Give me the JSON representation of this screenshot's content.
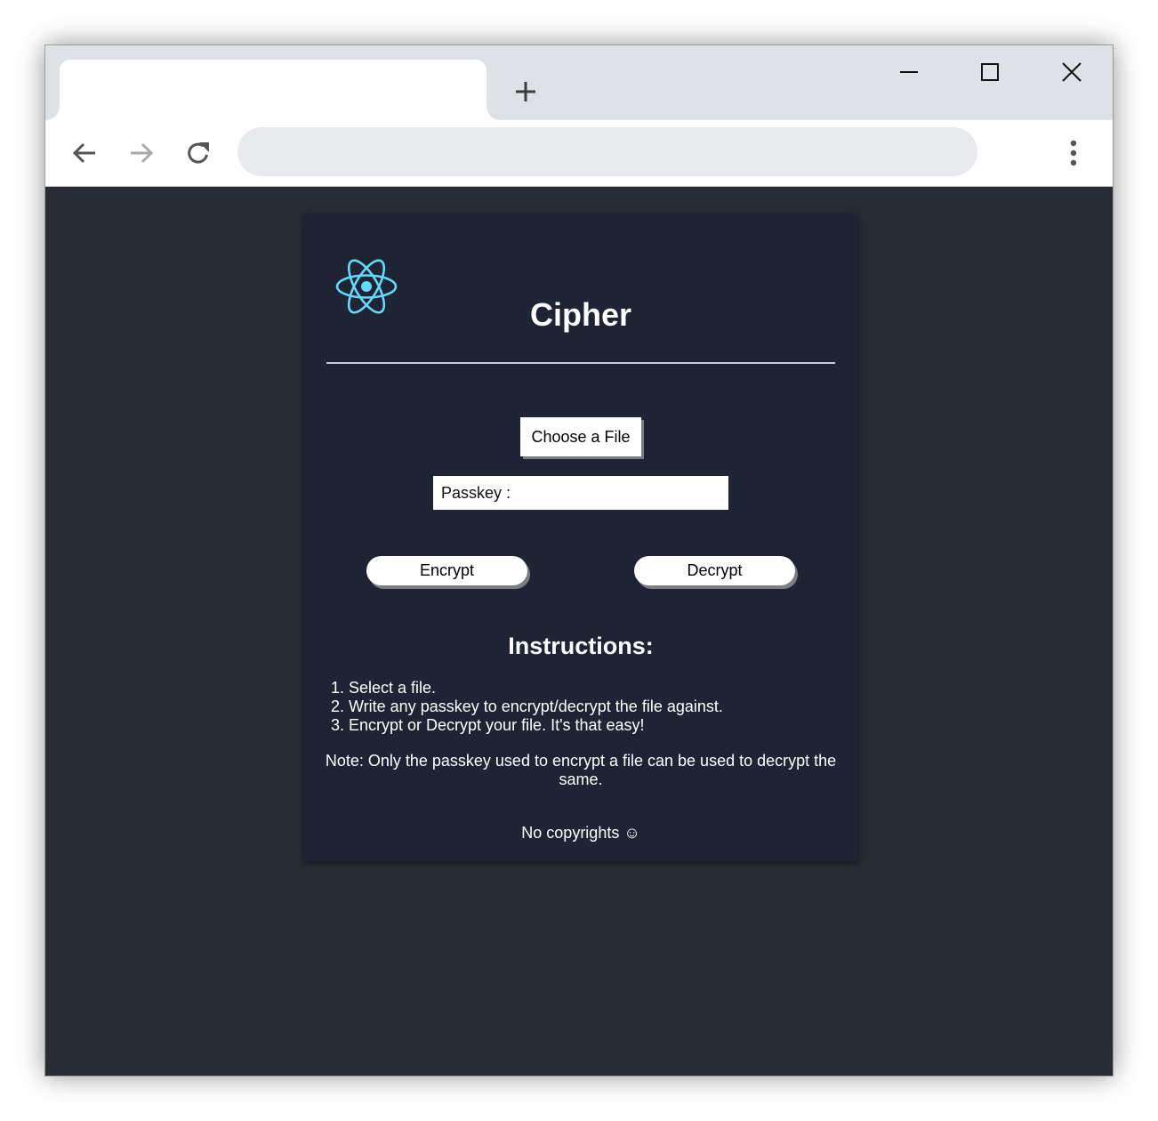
{
  "browser": {
    "tab_title": "",
    "new_tab_glyph": "+",
    "address_value": "",
    "icons": {
      "new_tab": "plus-icon",
      "minimize": "minimize-icon",
      "maximize": "maximize-icon",
      "close": "close-icon",
      "back": "arrow-left-icon",
      "forward": "arrow-right-icon",
      "reload": "reload-icon",
      "menu": "kebab-menu-icon"
    }
  },
  "app": {
    "logo_icon": "react-atom-icon",
    "title": "Cipher",
    "choose_file_label": "Choose a File",
    "passkey_placeholder": "Passkey :",
    "passkey_value": "",
    "encrypt_label": "Encrypt",
    "decrypt_label": "Decrypt",
    "instructions_title": "Instructions:",
    "steps": [
      "Select a file.",
      "Write any passkey to encrypt/decrypt the file against.",
      "Encrypt or Decrypt your file. It's that easy!"
    ],
    "note": "Note: Only the passkey used to encrypt a file can be used to decrypt the same.",
    "footer": "No copyrights ☺"
  },
  "colors": {
    "page_background": "#282c35",
    "card_background": "#1e2434",
    "accent_logo": "#61dafb",
    "text": "#ffffff",
    "tabstrip": "#dee1e6",
    "omnibox": "#e8eaed"
  }
}
